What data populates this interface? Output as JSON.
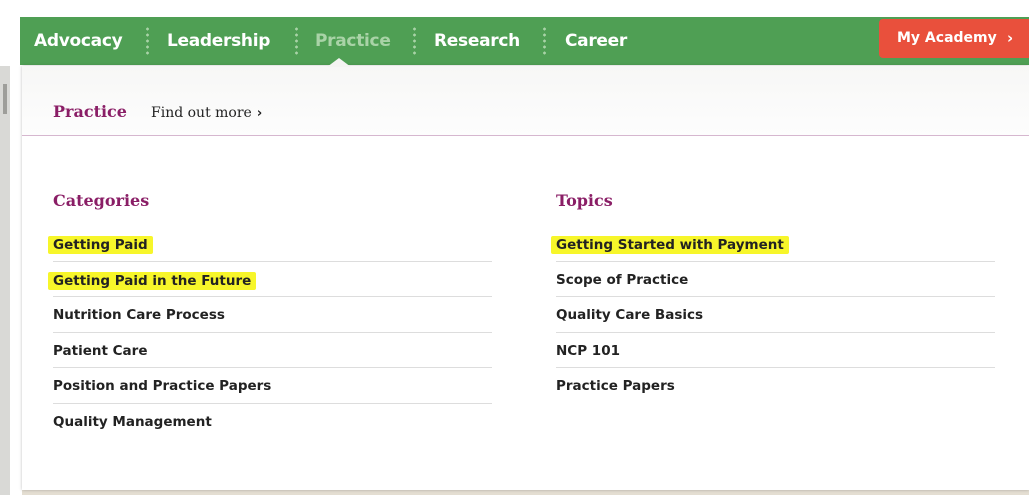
{
  "nav": {
    "items": [
      {
        "label": "Advocacy",
        "active": false
      },
      {
        "label": "Leadership",
        "active": false
      },
      {
        "label": "Practice",
        "active": true
      },
      {
        "label": "Research",
        "active": false
      },
      {
        "label": "Career",
        "active": false
      }
    ],
    "academy_button": {
      "label": "My Academy",
      "chevron": "›"
    }
  },
  "dropdown": {
    "title": "Practice",
    "find_more": "Find out more",
    "find_more_chevron": "›",
    "categories": {
      "heading": "Categories",
      "items": [
        {
          "label": "Getting Paid",
          "highlighted": true
        },
        {
          "label": "Getting Paid in the Future",
          "highlighted": true
        },
        {
          "label": "Nutrition Care Process",
          "highlighted": false
        },
        {
          "label": "Patient Care",
          "highlighted": false
        },
        {
          "label": "Position and Practice Papers",
          "highlighted": false
        },
        {
          "label": "Quality Management",
          "highlighted": false
        }
      ]
    },
    "topics": {
      "heading": "Topics",
      "items": [
        {
          "label": "Getting Started with Payment",
          "highlighted": true
        },
        {
          "label": "Scope of Practice",
          "highlighted": false
        },
        {
          "label": "Quality Care Basics",
          "highlighted": false
        },
        {
          "label": "NCP 101",
          "highlighted": false
        },
        {
          "label": "Practice Papers",
          "highlighted": false
        }
      ]
    }
  },
  "colors": {
    "nav_green": "#4f9f54",
    "nav_active_text": "#a9d3a7",
    "academy_red": "#e9503c",
    "heading_plum": "#8a1e66",
    "highlight_yellow": "#f7f62a"
  }
}
